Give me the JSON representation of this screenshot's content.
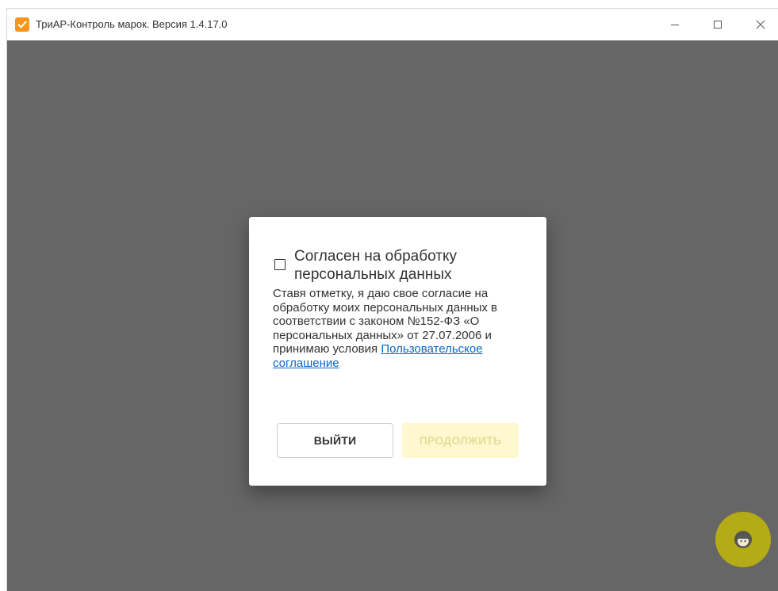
{
  "window": {
    "title": "ТриАР-Контроль марок. Версия 1.4.17.0",
    "icon": "checkmark-app-icon",
    "controls": [
      "minimize-icon",
      "maximize-icon",
      "close-icon"
    ]
  },
  "dialog": {
    "consent_label": "Согласен на обработку персональных данных",
    "checkbox_checked": false,
    "description": "Ставя отметку, я даю свое согласие на обработку моих персональных данных в соответствии с законом №152-ФЗ «О персональных данных» от 27.07.2006 и принимаю условия",
    "agreement_link": "Пользовательское соглашение",
    "buttons": {
      "exit": "ВЫЙТИ",
      "continue": "ПРОДОЛЖИТЬ"
    }
  },
  "support_button": {
    "icon": "support-agent-icon"
  },
  "colors": {
    "overlay": "#666666",
    "accent": "#f7941d",
    "continue_disabled_bg": "#fdf8cf",
    "continue_disabled_text": "#e5dd97",
    "link": "#0b66c3",
    "fab": "#b5ab16"
  }
}
